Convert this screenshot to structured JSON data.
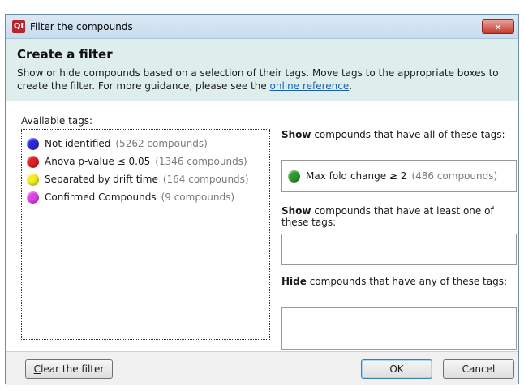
{
  "window": {
    "title": "Filter the compounds",
    "logo_text": "QI",
    "close_glyph": "×"
  },
  "header": {
    "heading": "Create a filter",
    "description_before_link": "Show or hide compounds based on a selection of their tags. Move tags to the appropriate boxes to create the filter. For more guidance, please see the ",
    "link_text": "online reference",
    "description_after_link": "."
  },
  "available": {
    "label": "Available tags:",
    "tags": [
      {
        "name": "Not identified",
        "count": "(5262 compounds)",
        "color": "#2a2ad8"
      },
      {
        "name": "Anova p-value ≤ 0.05",
        "count": "(1346 compounds)",
        "color": "#e02020"
      },
      {
        "name": "Separated by drift time",
        "count": "(164 compounds)",
        "color": "#f5ee1e"
      },
      {
        "name": "Confirmed Compounds",
        "count": "(9 compounds)",
        "color": "#e040e8"
      }
    ]
  },
  "show_all": {
    "label_bold": "Show",
    "label_rest": " compounds that have all of these tags:",
    "tags": [
      {
        "name": "Max fold change ≥ 2",
        "count": "(486 compounds)",
        "color": "#2e9a2e"
      }
    ]
  },
  "show_any": {
    "label_bold": "Show",
    "label_rest": " compounds that have at least one of these tags:"
  },
  "hide_any": {
    "label_bold": "Hide",
    "label_rest": " compounds that have any of these tags:"
  },
  "footer": {
    "clear_first_letter": "C",
    "clear_rest": "lear the filter",
    "ok": "OK",
    "cancel": "Cancel"
  }
}
